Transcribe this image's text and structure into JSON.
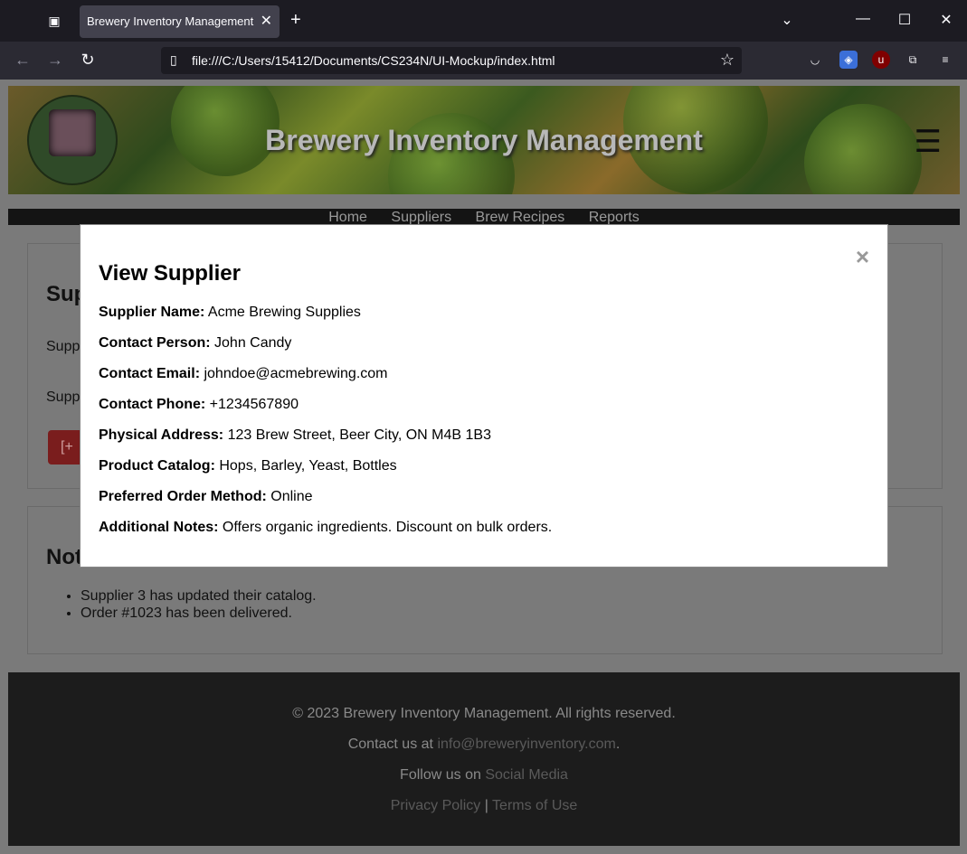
{
  "browser": {
    "tab_title": "Brewery Inventory Management",
    "url": "file:///C:/Users/15412/Documents/CS234N/UI-Mockup/index.html"
  },
  "site": {
    "title": "Brewery Inventory Management",
    "nav": [
      "Home",
      "Suppliers",
      "Brew Recipes",
      "Reports"
    ]
  },
  "background": {
    "card1_title": "Sup",
    "card1_line1": "Supp",
    "card1_line2": "Supp",
    "add_button": "[+",
    "card2_title": "Not",
    "notifications": [
      "Supplier 3 has updated their catalog.",
      "Order #1023 has been delivered."
    ]
  },
  "modal": {
    "title": "View Supplier",
    "close": "×",
    "fields": [
      {
        "label": "Supplier Name:",
        "value": "Acme Brewing Supplies"
      },
      {
        "label": "Contact Person:",
        "value": "John Candy"
      },
      {
        "label": "Contact Email:",
        "value": "johndoe@acmebrewing.com"
      },
      {
        "label": "Contact Phone:",
        "value": "+1234567890"
      },
      {
        "label": "Physical Address:",
        "value": "123 Brew Street, Beer City, ON M4B 1B3"
      },
      {
        "label": "Product Catalog:",
        "value": "Hops, Barley, Yeast, Bottles"
      },
      {
        "label": "Preferred Order Method:",
        "value": "Online"
      },
      {
        "label": "Additional Notes:",
        "value": "Offers organic ingredients. Discount on bulk orders."
      }
    ]
  },
  "footer": {
    "copyright": "© 2023 Brewery Inventory Management. All rights reserved.",
    "contact_prefix": "Contact us at",
    "contact_email": "info@breweryinventory.com",
    "contact_suffix": ".",
    "follow_prefix": "Follow us on",
    "follow_link": "Social Media",
    "privacy": "Privacy Policy",
    "separator": "|",
    "terms": "Terms of Use"
  }
}
